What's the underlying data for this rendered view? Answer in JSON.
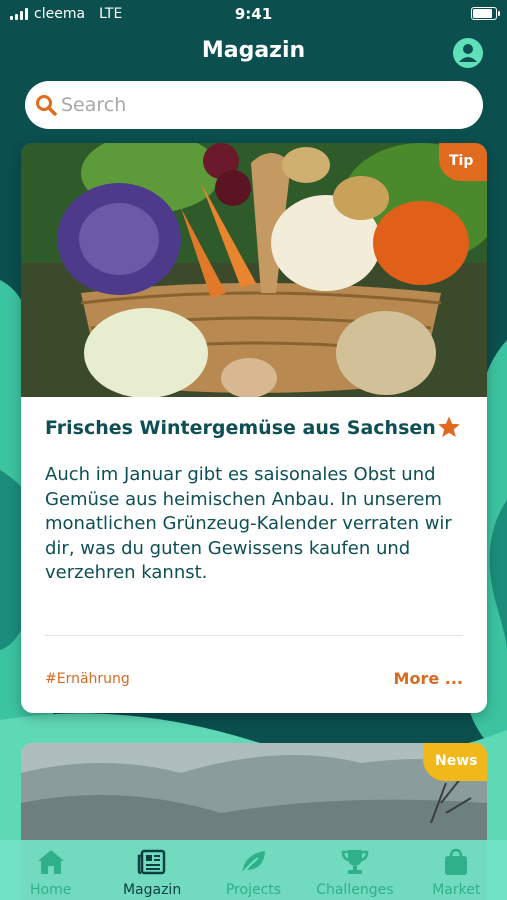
{
  "status": {
    "carrier": "cleema",
    "network": "LTE",
    "time": "9:41"
  },
  "header": {
    "title": "Magazin"
  },
  "search": {
    "placeholder": "Search"
  },
  "articles": [
    {
      "badge": "Tip",
      "title": "Frisches Wintergemüse aus Sachsen",
      "body": "Auch im Januar gibt es saisonales Obst und Gemüse aus heimischen Anbau. In unserem monatlichen Grünzeug-Kalender verraten wir dir, was du guten Gewissens kaufen und verzehren kannst.",
      "tag": "#Ernährung",
      "more": "More ...",
      "image": "vegetable-basket-photo"
    },
    {
      "badge": "News",
      "image": "misty-landscape-photo"
    }
  ],
  "tabs": [
    {
      "label": "Home",
      "icon": "home-icon"
    },
    {
      "label": "Magazin",
      "icon": "newspaper-icon",
      "active": true
    },
    {
      "label": "Projects",
      "icon": "leaf-icon"
    },
    {
      "label": "Challenges",
      "icon": "trophy-icon"
    },
    {
      "label": "Market",
      "icon": "shopping-bag-icon"
    }
  ],
  "colors": {
    "background": "#0b4f4f",
    "accent_orange": "#e06a1e",
    "news_yellow": "#f0b81a",
    "mint": "#5fe0b8",
    "text_dark": "#0d4f55"
  }
}
